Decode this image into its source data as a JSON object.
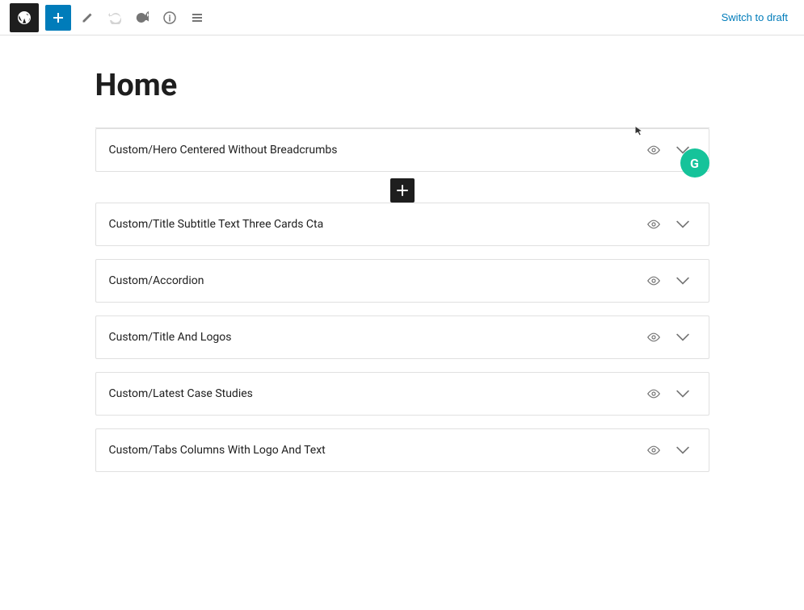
{
  "toolbar": {
    "add_label": "+",
    "switch_to_draft": "Switch to draft",
    "undo_title": "Undo",
    "redo_title": "Redo",
    "info_title": "Details",
    "list_view_title": "List View"
  },
  "page": {
    "title": "Home"
  },
  "blocks": [
    {
      "id": 1,
      "label": "Custom/Hero Centered Without Breadcrumbs"
    },
    {
      "id": 2,
      "label": "Custom/Title Subtitle Text Three Cards Cta"
    },
    {
      "id": 3,
      "label": "Custom/Accordion"
    },
    {
      "id": 4,
      "label": "Custom/Title And Logos"
    },
    {
      "id": 5,
      "label": "Custom/Latest Case Studies"
    },
    {
      "id": 6,
      "label": "Custom/Tabs Columns With Logo And Text"
    }
  ],
  "grammarly": {
    "label": "G"
  }
}
